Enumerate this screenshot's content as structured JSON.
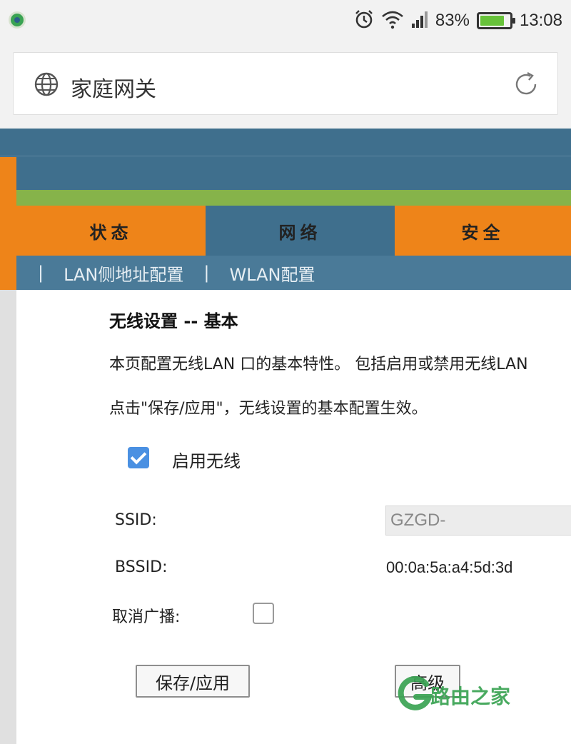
{
  "status_bar": {
    "battery": "83%",
    "battery_level": 0.83,
    "time": "13:08",
    "icons": [
      "alarm-icon",
      "wifi-icon",
      "signal-icon",
      "battery-icon"
    ]
  },
  "address_bar": {
    "title": "家庭网关",
    "icons": [
      "globe-icon",
      "reload-icon"
    ]
  },
  "nav": {
    "tabs": [
      {
        "label": "状态"
      },
      {
        "label": "网络"
      },
      {
        "label": "安全"
      }
    ],
    "active_tab": "网络",
    "subnav": {
      "separator": "|",
      "items": [
        {
          "label": "LAN侧地址配置"
        },
        {
          "label": "WLAN配置"
        }
      ]
    }
  },
  "content": {
    "title": "无线设置 -- 基本",
    "description_line1": "本页配置无线LAN 口的基本特性。 包括启用或禁用无线LAN",
    "description_line2": "点击\"保存/应用\"，无线设置的基本配置生效。",
    "enable_wireless": {
      "label": "启用无线",
      "checked": true
    },
    "ssid": {
      "label": "SSID:",
      "value": "GZGD-"
    },
    "bssid": {
      "label": "BSSID:",
      "value": "00:0a:5a:a4:5d:3d"
    },
    "hide_broadcast": {
      "label": "取消广播:",
      "checked": false
    },
    "buttons": {
      "save": "保存/应用",
      "advanced": "高级"
    }
  },
  "watermark": {
    "text": "路由之家"
  },
  "colors": {
    "nav_orange": "#ee8419",
    "nav_blue": "#3f6f8d",
    "stripe_green": "#86b34a",
    "checkbox_blue": "#4a90e2",
    "watermark_green": "#3aa353"
  }
}
